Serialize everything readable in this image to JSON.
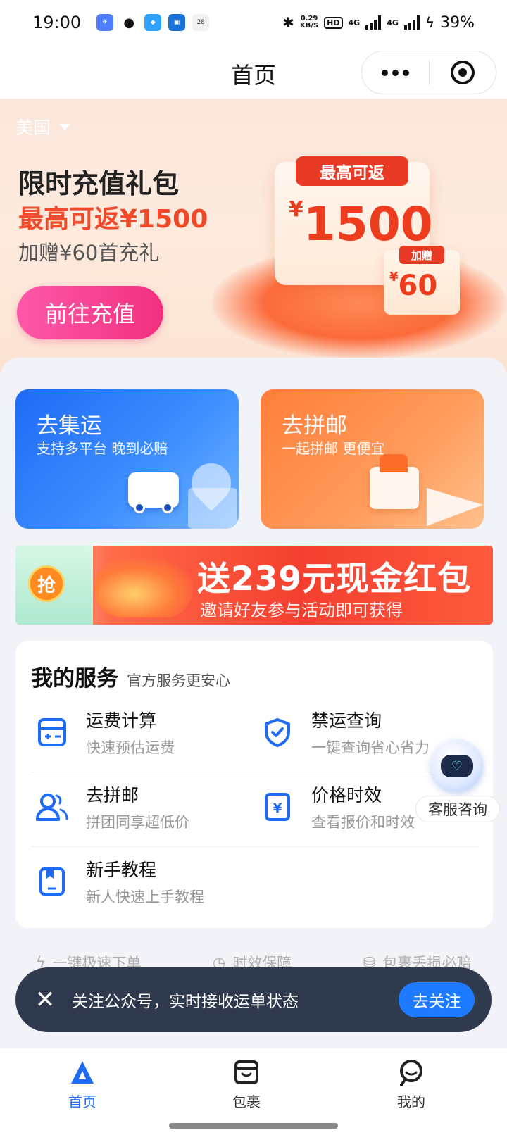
{
  "status_bar": {
    "time": "19:00",
    "net_speed_value": "0.29",
    "net_speed_unit": "KB/S",
    "hd": "HD",
    "sig1": "4G",
    "sig2": "4G",
    "battery": "39%"
  },
  "title_bar": {
    "title": "首页"
  },
  "hero": {
    "region": "美国",
    "title": "限时充值礼包",
    "subtitle": "最高可返¥1500",
    "bonus": "加赠¥60首充礼",
    "button": "前往充值",
    "promo_tag": "最高可返",
    "promo_currency": "¥",
    "promo_amount": "1500",
    "gift_tag": "加赠",
    "gift_currency": "¥",
    "gift_amount": "60"
  },
  "tiles": [
    {
      "title": "去集运",
      "subtitle": "支持多平台 晚到必赔"
    },
    {
      "title": "去拼邮",
      "subtitle": "一起拼邮 更便宜"
    }
  ],
  "promo_strip": {
    "badge": "抢",
    "title": "送239元现金红包",
    "subtitle": "邀请好友参与活动即可获得"
  },
  "services": {
    "title": "我的服务",
    "subtitle": "官方服务更安心",
    "items": [
      {
        "name": "运费计算",
        "desc": "快速预估运费",
        "icon": "calculator-icon"
      },
      {
        "name": "禁运查询",
        "desc": "一键查询省心省力",
        "icon": "shield-check-icon"
      },
      {
        "name": "去拼邮",
        "desc": "拼团同享超低价",
        "icon": "users-icon"
      },
      {
        "name": "价格时效",
        "desc": "查看报价和时效",
        "icon": "price-tag-icon"
      },
      {
        "name": "新手教程",
        "desc": "新人快速上手教程",
        "icon": "book-icon"
      }
    ]
  },
  "customer_service": {
    "label": "客服咨询"
  },
  "features": [
    {
      "label": "一键极速下单",
      "icon": "lightning-icon"
    },
    {
      "label": "时效保障",
      "icon": "clock-icon"
    },
    {
      "label": "包裹丢损必赔",
      "icon": "coins-icon"
    }
  ],
  "toast": {
    "text": "关注公众号，实时接收运单状态",
    "button": "去关注"
  },
  "tabbar": [
    {
      "label": "首页",
      "active": true
    },
    {
      "label": "包裹",
      "active": false
    },
    {
      "label": "我的",
      "active": false
    }
  ],
  "colors": {
    "primary": "#1e6bf6",
    "accent_red": "#f04a2a",
    "toast_bg": "#2f3a4e"
  }
}
